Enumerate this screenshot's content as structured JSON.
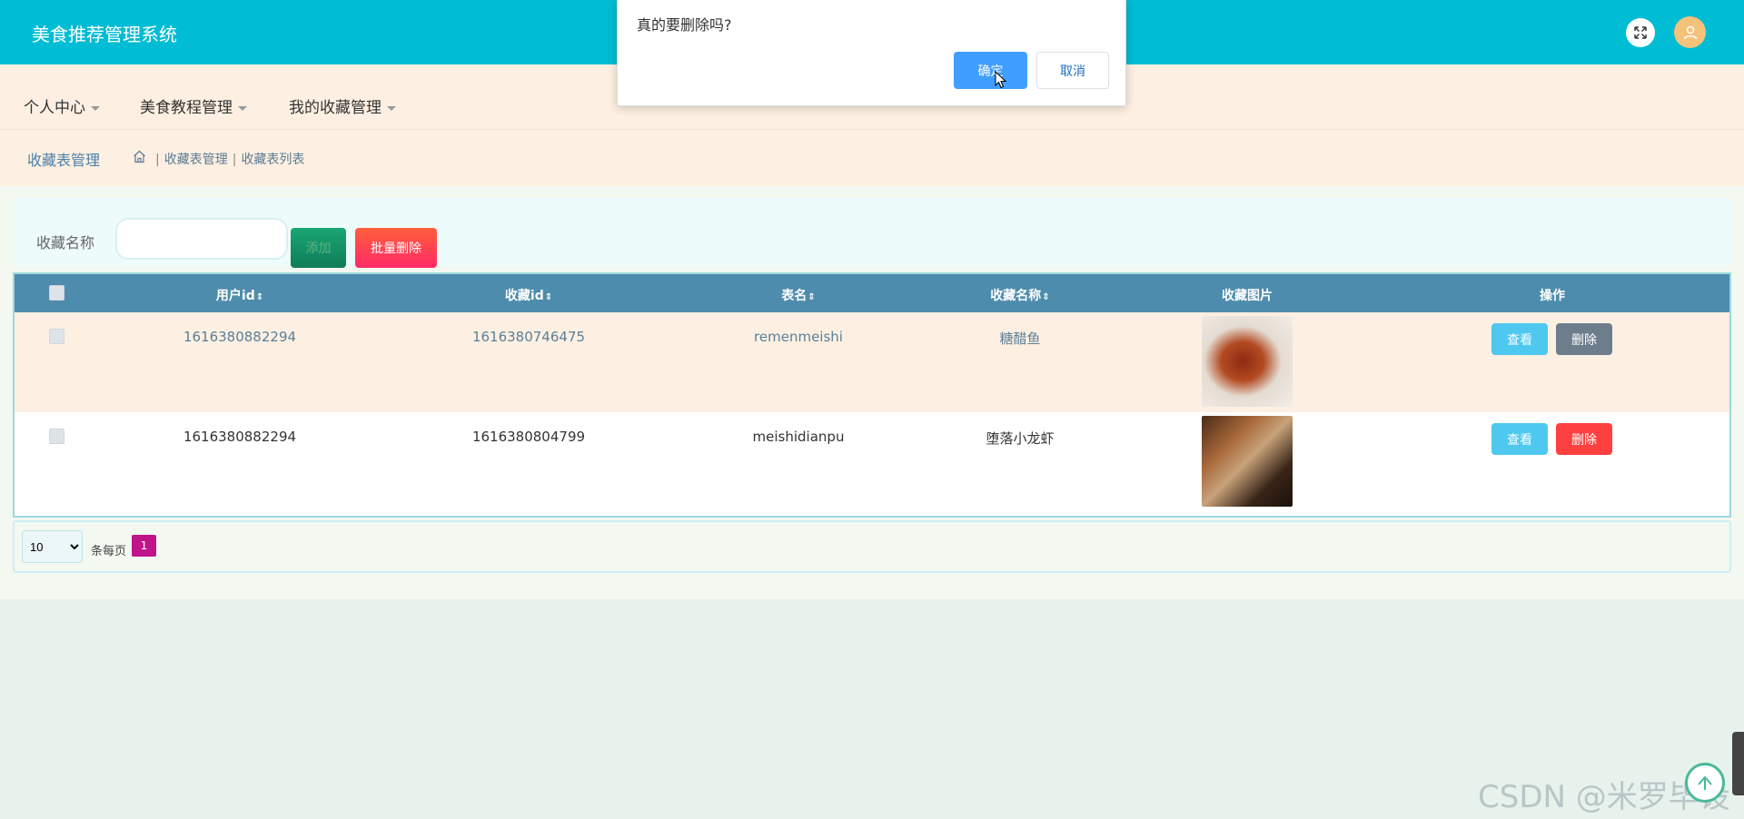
{
  "header": {
    "title": "美食推荐管理系统"
  },
  "nav": {
    "items": [
      {
        "label": "个人中心"
      },
      {
        "label": "美食教程管理"
      },
      {
        "label": "我的收藏管理"
      }
    ]
  },
  "breadcrumb": {
    "page_title": "收藏表管理",
    "items": [
      "收藏表管理",
      "收藏表列表"
    ]
  },
  "search": {
    "label": "收藏名称",
    "value": "",
    "add_label": "添加",
    "batch_delete_label": "批量删除"
  },
  "table": {
    "headers": [
      "用户id",
      "收藏id",
      "表名",
      "收藏名称",
      "收藏图片",
      "操作"
    ],
    "rows": [
      {
        "user_id": "1616380882294",
        "fav_id": "1616380746475",
        "table_name": "remenmeishi",
        "fav_name": "糖醋鱼",
        "image": "sweet-sour-fish",
        "view_label": "查看",
        "delete_label": "删除"
      },
      {
        "user_id": "1616380882294",
        "fav_id": "1616380804799",
        "table_name": "meishidianpu",
        "fav_name": "堕落小龙虾",
        "image": "crayfish-restaurant",
        "view_label": "查看",
        "delete_label": "删除"
      }
    ]
  },
  "pagination": {
    "page_size": "10",
    "per_page_label": "条每页",
    "current_page": "1"
  },
  "dialog": {
    "message": "真的要删除吗?",
    "confirm_label": "确定",
    "cancel_label": "取消"
  },
  "watermark": "CSDN @米罗毕设",
  "colors": {
    "header_bg": "#00bcd4",
    "table_header_bg": "#4e8cad",
    "confirm": "#409eff",
    "view": "#4fc8f0",
    "delete": "#ff4040",
    "page_active": "#c0158a"
  }
}
